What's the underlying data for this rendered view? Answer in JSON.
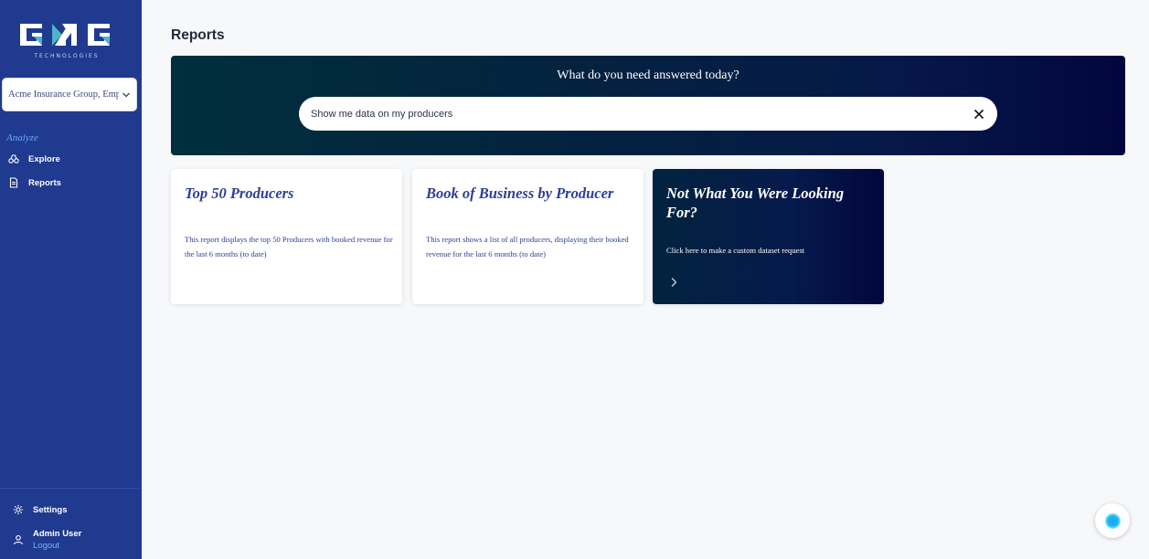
{
  "brand": {
    "logo_tagline": "TECHNOLOGIES",
    "accent_color": "#1f3a8f",
    "logo_accent_color": "#4fb3c8"
  },
  "sidebar": {
    "org_selector": {
      "value": "Acme Insurance Group, Emp...",
      "icon": "chevron-down-icon"
    },
    "section_label": "Analyze",
    "items": [
      {
        "label": "Explore",
        "icon": "explore-icon"
      },
      {
        "label": "Reports",
        "icon": "document-icon"
      }
    ],
    "settings_label": "Settings",
    "user": {
      "name": "Admin User",
      "logout_label": "Logout"
    }
  },
  "main": {
    "page_title": "Reports",
    "hero": {
      "question": "What do you need answered today?",
      "search_value": "Show me data on my producers"
    },
    "cards": [
      {
        "title": "Top 50 Producers",
        "description": "This report displays the top 50 Producers with booked revenue for the last 6 months (to date)"
      },
      {
        "title": "Book of Business by Producer",
        "description": "This report shows a list of all producers, displaying their booked revenue for the last 6 months (to date)"
      },
      {
        "title": "Not What You Were Looking For?",
        "description": "Click here to make a custom dataset request"
      }
    ]
  }
}
